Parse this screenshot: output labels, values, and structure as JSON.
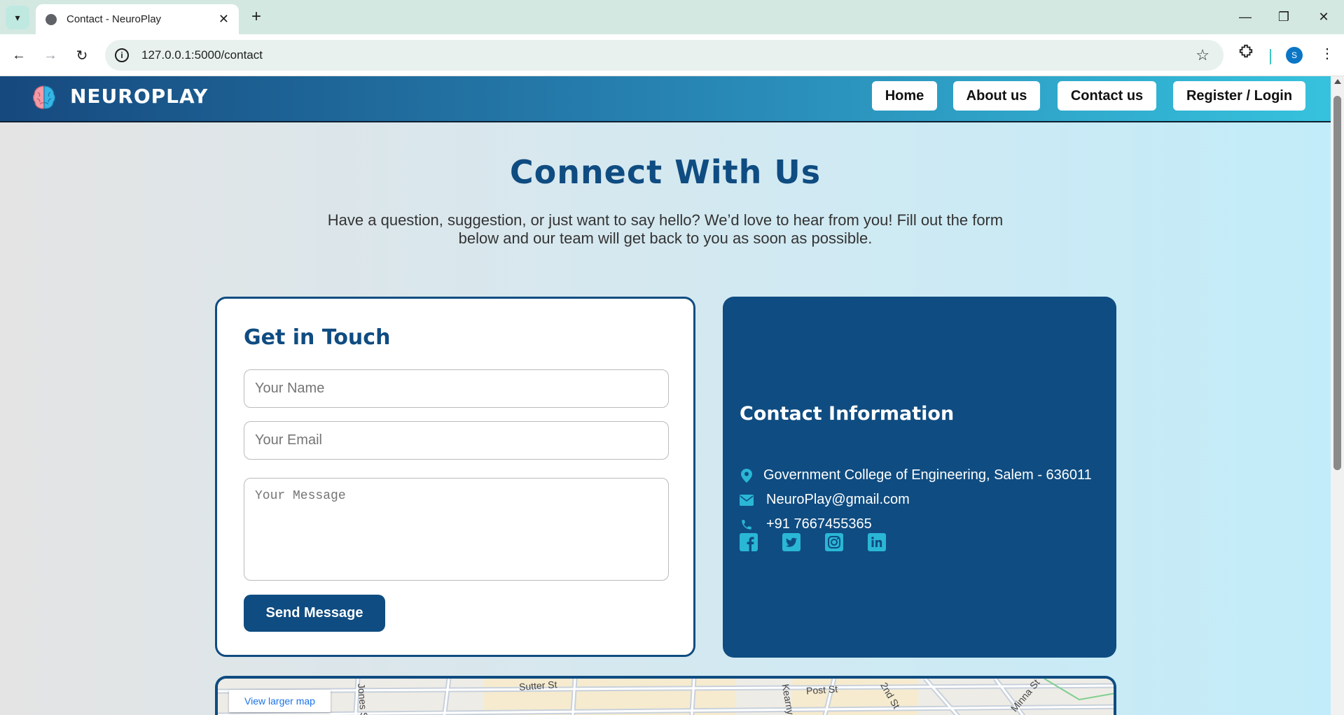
{
  "browser": {
    "tab_title": "Contact - NeuroPlay",
    "url": "127.0.0.1:5000/contact",
    "profile_initial": "S"
  },
  "site": {
    "brand": "NEUROPLAY",
    "nav": [
      "Home",
      "About us",
      "Contact us",
      "Register / Login"
    ]
  },
  "hero": {
    "title": "Connect With Us",
    "subtitle": "Have a question, suggestion, or just want to say hello? We’d love to hear from you! Fill out the form below and our team will get back to you as soon as possible."
  },
  "form": {
    "title": "Get in Touch",
    "name_placeholder": "Your Name",
    "email_placeholder": "Your Email",
    "message_placeholder": "Your Message",
    "submit_label": "Send Message"
  },
  "contact_info": {
    "title": "Contact Information",
    "address": "Government College of Engineering, Salem - 636011",
    "email": "NeuroPlay@gmail.com",
    "phone": "+91 7667455365",
    "socials": [
      "facebook-icon",
      "twitter-icon",
      "instagram-icon",
      "linkedin-icon"
    ]
  },
  "map": {
    "larger_map_label": "View larger map",
    "streets": [
      "Sutter St",
      "Post St",
      "Kearny St",
      "2nd St",
      "Minna St",
      "Jones St"
    ]
  },
  "colors": {
    "primary": "#0f4c81",
    "accent": "#36c2dd",
    "icon_accent": "#2ab7d6"
  }
}
